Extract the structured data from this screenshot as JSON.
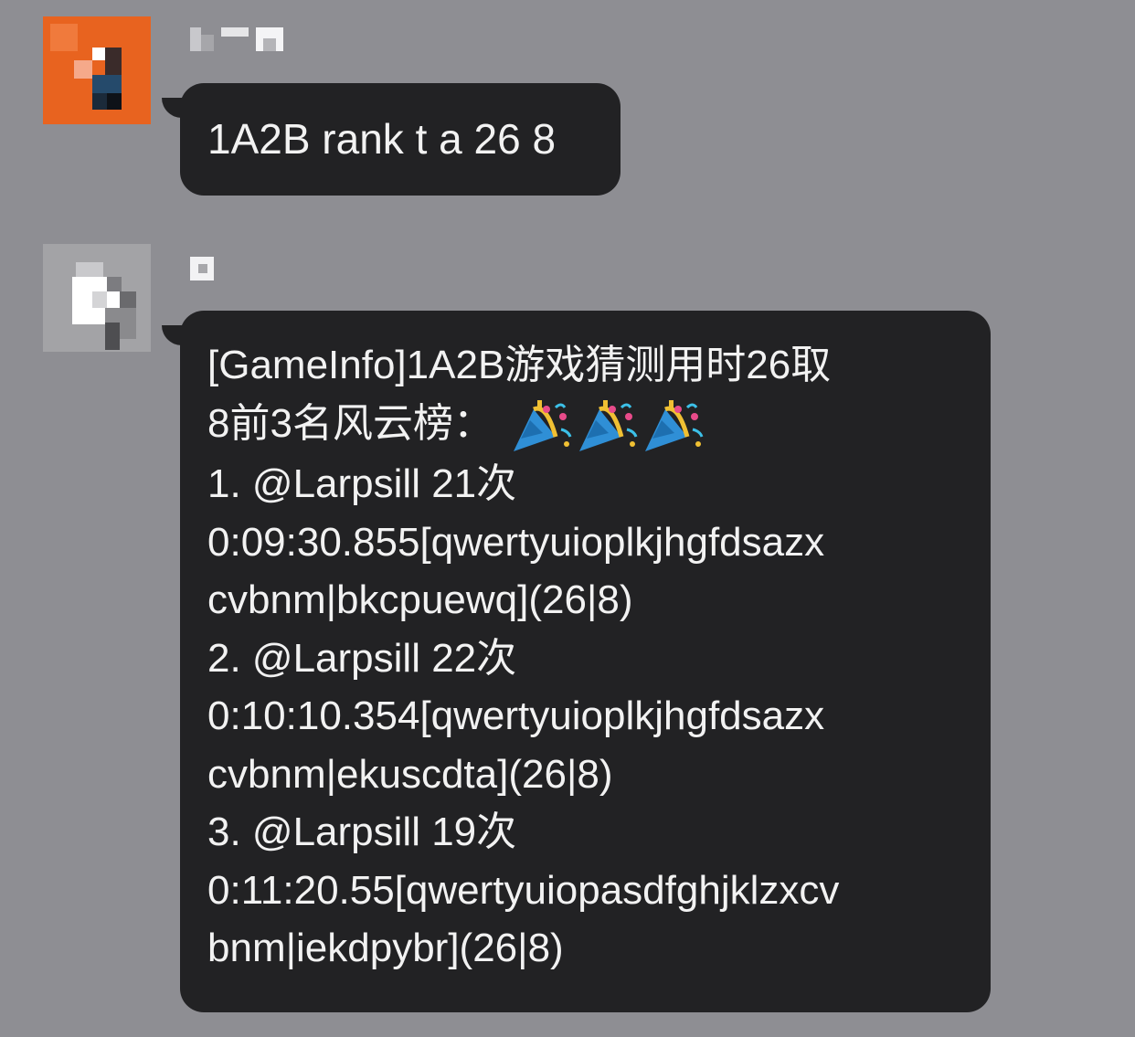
{
  "messages": [
    {
      "sender": "",
      "avatar": "pixelated-orange-avatar",
      "lines": [
        "1A2B rank t a 26 8"
      ]
    },
    {
      "sender": "",
      "avatar": "pixelated-gray-avatar",
      "lines": [
        "[GameInfo]1A2B游戏猜测用时26取",
        "8前3名风云榜：",
        "1. @Larpsill 21次",
        "0:09:30.855[qwertyuioplkjhgfdsazx",
        "cvbnm|bkcpuewq](26|8)",
        "2. @Larpsill 22次",
        "0:10:10.354[qwertyuioplkjhgfdsazx",
        "cvbnm|ekuscdta](26|8)",
        "3. @Larpsill 19次",
        "0:11:20.55[qwertyuiopasdfghjklzxcv",
        "bnm|iekdpybr](26|8)"
      ],
      "emoji": [
        "party-popper-icon",
        "party-popper-icon",
        "party-popper-icon"
      ]
    }
  ],
  "colors": {
    "background": "#8e8e93",
    "bubble": "#222224",
    "text": "#f2f2f2",
    "avatar_orange": "#e8631f"
  }
}
